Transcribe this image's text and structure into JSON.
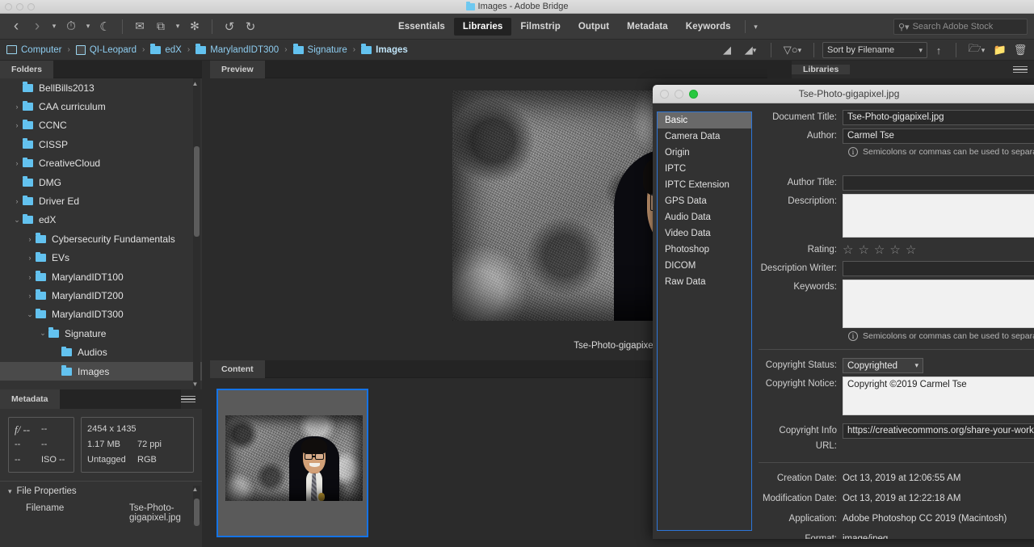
{
  "window": {
    "title": "Images - Adobe Bridge",
    "traffic_lights": [
      "close",
      "minimize",
      "zoom"
    ]
  },
  "toolbar": {
    "nav_icons": [
      {
        "name": "back-icon",
        "glyph": "‹"
      },
      {
        "name": "forward-icon",
        "glyph": "›"
      },
      {
        "name": "nav-dropdown-icon",
        "glyph": "⌄"
      },
      {
        "name": "recent-history-icon",
        "glyph": "◴"
      },
      {
        "name": "recent-dropdown-icon",
        "glyph": "⌄"
      },
      {
        "name": "boomerang-icon",
        "glyph": "☾"
      }
    ],
    "action_icons": [
      {
        "name": "camera-import-icon",
        "glyph": "◎"
      },
      {
        "name": "refine-stack-icon",
        "glyph": "⧉"
      },
      {
        "name": "refine-dropdown-icon",
        "glyph": "⌄"
      },
      {
        "name": "open-in-camera-raw-icon",
        "glyph": "✻"
      }
    ],
    "rotate_icons": [
      {
        "name": "rotate-counterclockwise-icon",
        "glyph": "↺"
      },
      {
        "name": "rotate-clockwise-icon",
        "glyph": "↻"
      }
    ],
    "workspaces": [
      {
        "label": "Essentials",
        "active": false
      },
      {
        "label": "Libraries",
        "active": true
      },
      {
        "label": "Filmstrip",
        "active": false
      },
      {
        "label": "Output",
        "active": false
      },
      {
        "label": "Metadata",
        "active": false
      },
      {
        "label": "Keywords",
        "active": false
      }
    ],
    "workspace_overflow_icon": "chevron-down-icon",
    "search": {
      "placeholder": "Search Adobe Stock",
      "icon": "search-icon"
    }
  },
  "pathbar": {
    "crumbs": [
      {
        "label": "Computer",
        "icon": "computer-icon"
      },
      {
        "label": "QI-Leopard",
        "icon": "drive-icon"
      },
      {
        "label": "edX",
        "icon": "folder-icon"
      },
      {
        "label": "MarylandIDT300",
        "icon": "folder-icon"
      },
      {
        "label": "Signature",
        "icon": "folder-icon"
      },
      {
        "label": "Images",
        "icon": "folder-icon"
      }
    ],
    "separator": "›",
    "right_icons": [
      {
        "name": "filter-rating-icon",
        "glyph": "◢"
      },
      {
        "name": "filter-rating-dropdown-icon",
        "glyph": "◢"
      },
      {
        "name": "filter-items-icon",
        "glyph": "∇"
      }
    ],
    "sort": {
      "label": "Sort by Filename",
      "chevron": "⌄",
      "ascending_icon": "arrow-up-icon"
    },
    "tail_icons": [
      {
        "name": "new-folder-recent-icon",
        "glyph": "◱"
      },
      {
        "name": "new-folder-icon",
        "glyph": "▬"
      },
      {
        "name": "delete-icon",
        "glyph": "⌧"
      }
    ]
  },
  "panels": {
    "folders_tab": "Folders",
    "preview_tab": "Preview",
    "content_tab": "Content",
    "metadata_tab": "Metadata",
    "libraries_tab": "Libraries"
  },
  "folder_tree": [
    {
      "label": "BellBills2013",
      "indent": 1,
      "twisty": "",
      "selected": false
    },
    {
      "label": "CAA curriculum",
      "indent": 1,
      "twisty": "›",
      "selected": false
    },
    {
      "label": "CCNC",
      "indent": 1,
      "twisty": "›",
      "selected": false
    },
    {
      "label": "CISSP",
      "indent": 1,
      "twisty": "",
      "selected": false
    },
    {
      "label": "CreativeCloud",
      "indent": 1,
      "twisty": "›",
      "selected": false
    },
    {
      "label": "DMG",
      "indent": 1,
      "twisty": "",
      "selected": false
    },
    {
      "label": "Driver Ed",
      "indent": 1,
      "twisty": "›",
      "selected": false
    },
    {
      "label": "edX",
      "indent": 1,
      "twisty": "⌄",
      "selected": false
    },
    {
      "label": "Cybersecurity Fundamentals",
      "indent": 2,
      "twisty": "›",
      "selected": false
    },
    {
      "label": "EVs",
      "indent": 2,
      "twisty": "›",
      "selected": false
    },
    {
      "label": "MarylandIDT100",
      "indent": 2,
      "twisty": "›",
      "selected": false
    },
    {
      "label": "MarylandIDT200",
      "indent": 2,
      "twisty": "›",
      "selected": false
    },
    {
      "label": "MarylandIDT300",
      "indent": 2,
      "twisty": "⌄",
      "selected": false
    },
    {
      "label": "Signature",
      "indent": 3,
      "twisty": "⌄",
      "selected": false
    },
    {
      "label": "Audios",
      "indent": 4,
      "twisty": "",
      "selected": false
    },
    {
      "label": "Images",
      "indent": 4,
      "twisty": "",
      "selected": true
    }
  ],
  "metadata_panel": {
    "camera_card": [
      {
        "left": "f/ --",
        "right": "--"
      },
      {
        "left": "--",
        "right": "--"
      },
      {
        "left": "--",
        "right": "ISO --"
      }
    ],
    "image_card": [
      {
        "left": "2454 x 1435",
        "right": ""
      },
      {
        "left": "1.17 MB",
        "right": "72 ppi"
      },
      {
        "left": "Untagged",
        "right": "RGB"
      }
    ],
    "file_properties_title": "File Properties",
    "file_properties_rows": [
      {
        "key": "Filename",
        "value": "Tse-Photo-gigapixel.jpg"
      }
    ]
  },
  "preview": {
    "caption": "Tse-Photo-gigapixel.jpg"
  },
  "file_info_dialog": {
    "title": "Tse-Photo-gigapixel.jpg",
    "nav": [
      {
        "label": "Basic",
        "active": true
      },
      {
        "label": "Camera Data",
        "active": false
      },
      {
        "label": "Origin",
        "active": false
      },
      {
        "label": "IPTC",
        "active": false
      },
      {
        "label": "IPTC Extension",
        "active": false
      },
      {
        "label": "GPS Data",
        "active": false
      },
      {
        "label": "Audio Data",
        "active": false
      },
      {
        "label": "Video Data",
        "active": false
      },
      {
        "label": "Photoshop",
        "active": false
      },
      {
        "label": "DICOM",
        "active": false
      },
      {
        "label": "Raw Data",
        "active": false
      }
    ],
    "fields": {
      "document_title_label": "Document Title:",
      "document_title_value": "Tse-Photo-gigapixel.jpg",
      "author_label": "Author:",
      "author_value": "Carmel Tse",
      "author_hint": "Semicolons or commas can be used to separate multi",
      "author_title_label": "Author Title:",
      "author_title_value": "",
      "description_label": "Description:",
      "description_value": "",
      "rating_label": "Rating:",
      "rating_value": 0,
      "rating_max": 5,
      "description_writer_label": "Description Writer:",
      "description_writer_value": "",
      "keywords_label": "Keywords:",
      "keywords_value": "",
      "keywords_hint": "Semicolons or commas can be used to separate multi",
      "copyright_status_label": "Copyright Status:",
      "copyright_status_value": "Copyrighted",
      "copyright_notice_label": "Copyright Notice:",
      "copyright_notice_value": "Copyright ©2019 Carmel Tse",
      "copyright_url_label": "Copyright Info URL:",
      "copyright_url_value": "https://creativecommons.org/share-your-work/licens"
    },
    "readonly": [
      {
        "label": "Creation Date:",
        "value": "Oct 13, 2019 at 12:06:55 AM"
      },
      {
        "label": "Modification Date:",
        "value": "Oct 13, 2019 at 12:22:18 AM"
      },
      {
        "label": "Application:",
        "value": "Adobe Photoshop CC 2019 (Macintosh)"
      },
      {
        "label": "Format:",
        "value": "image/jpeg"
      }
    ]
  },
  "colors": {
    "accent_blue": "#1473e6",
    "folder_blue": "#63c2ef",
    "panel_bg": "#333333",
    "app_bg": "#2b2b2b",
    "selection_green": "#28c840"
  }
}
